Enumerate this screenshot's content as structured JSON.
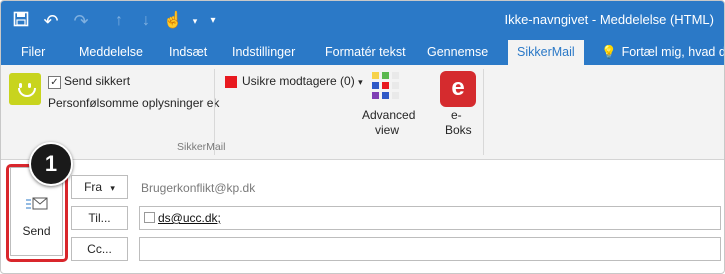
{
  "window": {
    "title": "Ikke-navngivet - Meddelelse (HTML)"
  },
  "qat": {
    "more_icon": "▾"
  },
  "tabs": [
    {
      "label": "Filer"
    },
    {
      "label": "Meddelelse"
    },
    {
      "label": "Indsæt"
    },
    {
      "label": "Indstillinger"
    },
    {
      "label": "Formatér tekst"
    },
    {
      "label": "Gennemse"
    },
    {
      "label": "SikkerMail"
    },
    {
      "label": "Fortæl mig, hvad d"
    }
  ],
  "ribbon": {
    "send_secure_label": "Send sikkert",
    "send_secure_checked": true,
    "personal_info_label": "Personfølsomme oplysninger ek",
    "unsafe_recipients_label": "Usikre modtagere (0)",
    "advanced_view_line1": "Advanced",
    "advanced_view_line2": "view",
    "eboks_letter": "e",
    "eboks_line1": "e-",
    "eboks_line2": "Boks",
    "group_label": "SikkerMail",
    "brand_color": "#c8d41e",
    "alert_color": "#e8191f"
  },
  "compose": {
    "send_label": "Send",
    "from_button": "Fra",
    "from_value": "Brugerkonflikt@kp.dk",
    "to_button": "Til...",
    "to_value": "ds@ucc.dk;",
    "cc_button": "Cc...",
    "cc_value": ""
  },
  "annotation": {
    "step_number": "1",
    "highlight_color": "#d9262c"
  }
}
